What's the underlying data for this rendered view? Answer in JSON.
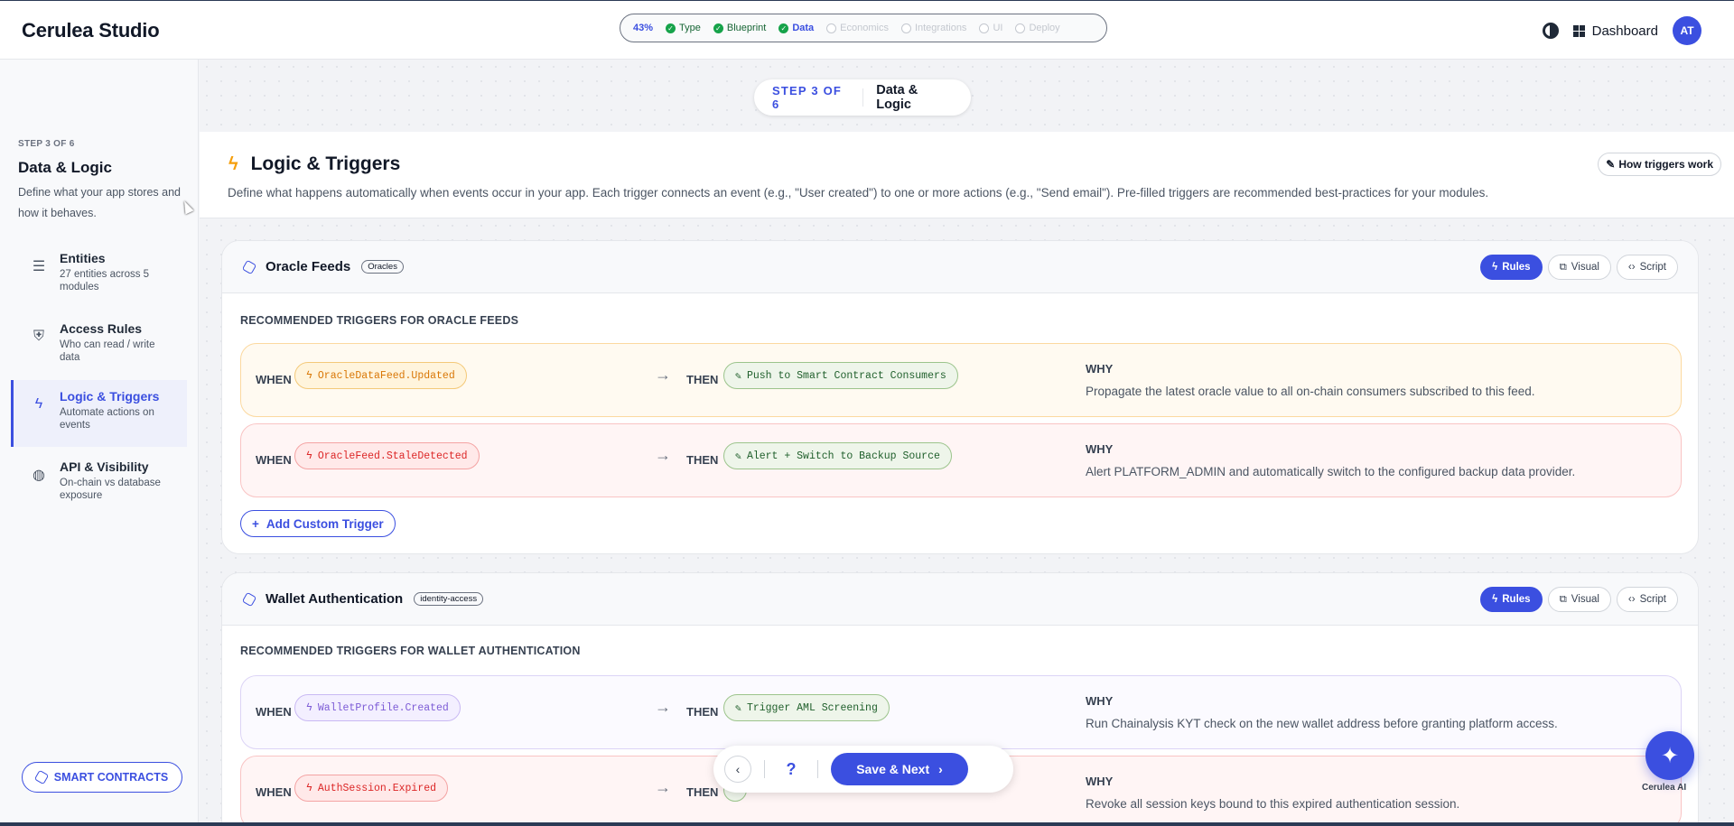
{
  "app": {
    "brand": "Cerulea Studio"
  },
  "progress": {
    "percent": "43%",
    "steps": [
      {
        "label": "Type",
        "state": "done"
      },
      {
        "label": "Blueprint",
        "state": "done"
      },
      {
        "label": "Data",
        "state": "current"
      },
      {
        "label": "Economics",
        "state": "todo"
      },
      {
        "label": "Integrations",
        "state": "todo"
      },
      {
        "label": "UI",
        "state": "todo"
      },
      {
        "label": "Deploy",
        "state": "todo"
      }
    ]
  },
  "header": {
    "dashboard_label": "Dashboard",
    "avatar_initials": "AT"
  },
  "sidebar": {
    "step": "STEP 3 OF 6",
    "title": "Data & Logic",
    "description": "Define what your app stores and how it behaves.",
    "items": [
      {
        "title": "Entities",
        "subtitle": "27 entities across 5 modules",
        "icon": "list-icon"
      },
      {
        "title": "Access Rules",
        "subtitle": "Who can read / write data",
        "icon": "shield-icon"
      },
      {
        "title": "Logic & Triggers",
        "subtitle": "Automate actions on events",
        "icon": "bolt-icon"
      },
      {
        "title": "API & Visibility",
        "subtitle": "On-chain vs database exposure",
        "icon": "globe-icon"
      }
    ],
    "smart_contracts_label": "SMART CONTRACTS"
  },
  "step_pill": {
    "step": "STEP 3 OF 6",
    "name": "Data & Logic"
  },
  "page": {
    "title": "Logic & Triggers",
    "description": "Define what happens automatically when events occur in your app. Each trigger connects an event (e.g., \"User created\") to one or more actions (e.g., \"Send email\"). Pre-filled triggers are recommended best-practices for your modules.",
    "how_label": "How triggers work"
  },
  "labels": {
    "when": "WHEN",
    "then": "THEN",
    "why": "WHY",
    "arrow": "→",
    "add_custom": "Add Custom Trigger"
  },
  "modules": [
    {
      "name": "Oracle Feeds",
      "tag": "Oracles",
      "tabs": [
        "Rules",
        "Visual",
        "Script"
      ],
      "subtitle": "RECOMMENDED TRIGGERS FOR ORACLE FEEDS",
      "triggers": [
        {
          "event": "OracleDataFeed.Updated",
          "action": "Push to Smart Contract Consumers",
          "why": "Propagate the latest oracle value to all on-chain consumers subscribed to this feed.",
          "tone": "amber"
        },
        {
          "event": "OracleFeed.StaleDetected",
          "action": "Alert + Switch to Backup Source",
          "why": "Alert PLATFORM_ADMIN and automatically switch to the configured backup data provider.",
          "tone": "red"
        }
      ]
    },
    {
      "name": "Wallet Authentication",
      "tag": "identity-access",
      "tabs": [
        "Rules",
        "Visual",
        "Script"
      ],
      "subtitle": "RECOMMENDED TRIGGERS FOR WALLET AUTHENTICATION",
      "triggers": [
        {
          "event": "WalletProfile.Created",
          "action": "Trigger AML Screening",
          "why": "Run Chainalysis KYT check on the new wallet address before granting platform access.",
          "tone": "purple"
        },
        {
          "event": "AuthSession.Expired",
          "action": "",
          "why": "Revoke all session keys bound to this expired authentication session.",
          "tone": "red"
        }
      ]
    }
  ],
  "footer_nav": {
    "help": "?",
    "save_next": "Save & Next"
  },
  "ai": {
    "label": "Cerulea AI"
  }
}
